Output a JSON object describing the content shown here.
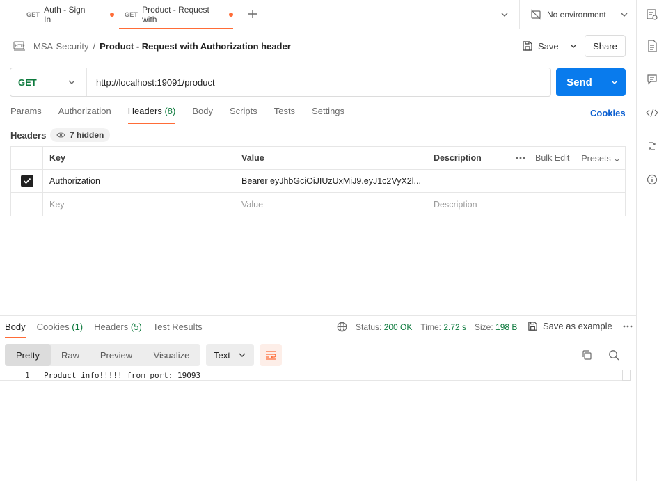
{
  "tabs": [
    {
      "method": "GET",
      "label": "Auth - Sign In"
    },
    {
      "method": "GET",
      "label": "Product - Request with"
    }
  ],
  "environment": {
    "label": "No environment"
  },
  "breadcrumb": {
    "collection": "MSA-Security",
    "separator": "/",
    "request": "Product - Request with Authorization header"
  },
  "actions": {
    "save": "Save",
    "share": "Share"
  },
  "request": {
    "method": "GET",
    "url": "http://localhost:19091/product",
    "send": "Send"
  },
  "request_tabs": [
    {
      "label": "Params",
      "count": ""
    },
    {
      "label": "Authorization",
      "count": ""
    },
    {
      "label": "Headers",
      "count": "(8)"
    },
    {
      "label": "Body",
      "count": ""
    },
    {
      "label": "Scripts",
      "count": ""
    },
    {
      "label": "Tests",
      "count": ""
    },
    {
      "label": "Settings",
      "count": ""
    }
  ],
  "cookies_link": "Cookies",
  "headers_section": {
    "title": "Headers",
    "hidden": "7 hidden"
  },
  "table": {
    "columns": [
      "Key",
      "Value",
      "Description"
    ],
    "bulk_edit": "Bulk Edit",
    "presets": "Presets",
    "rows": [
      {
        "key": "Authorization",
        "value": "Bearer eyJhbGciOiJIUzUxMiJ9.eyJ1c2VyX2l...",
        "description": ""
      }
    ],
    "placeholder": {
      "key": "Key",
      "value": "Value",
      "description": "Description"
    }
  },
  "response_tabs": [
    {
      "label": "Body",
      "count": ""
    },
    {
      "label": "Cookies",
      "count": "(1)"
    },
    {
      "label": "Headers",
      "count": "(5)"
    },
    {
      "label": "Test Results",
      "count": ""
    }
  ],
  "status": {
    "status_label": "Status:",
    "status_value": "200 OK",
    "time_label": "Time:",
    "time_value": "2.72 s",
    "size_label": "Size:",
    "size_value": "198 B"
  },
  "save_example": "Save as example",
  "view_modes": [
    "Pretty",
    "Raw",
    "Preview",
    "Visualize"
  ],
  "format": "Text",
  "body_lines": [
    {
      "num": "1",
      "text": "Product info!!!!! from port: 19093"
    }
  ],
  "colors": {
    "accent": "#ff6c37",
    "send": "#097bed",
    "get": "#0d7a3d",
    "link": "#0b5fd1"
  }
}
